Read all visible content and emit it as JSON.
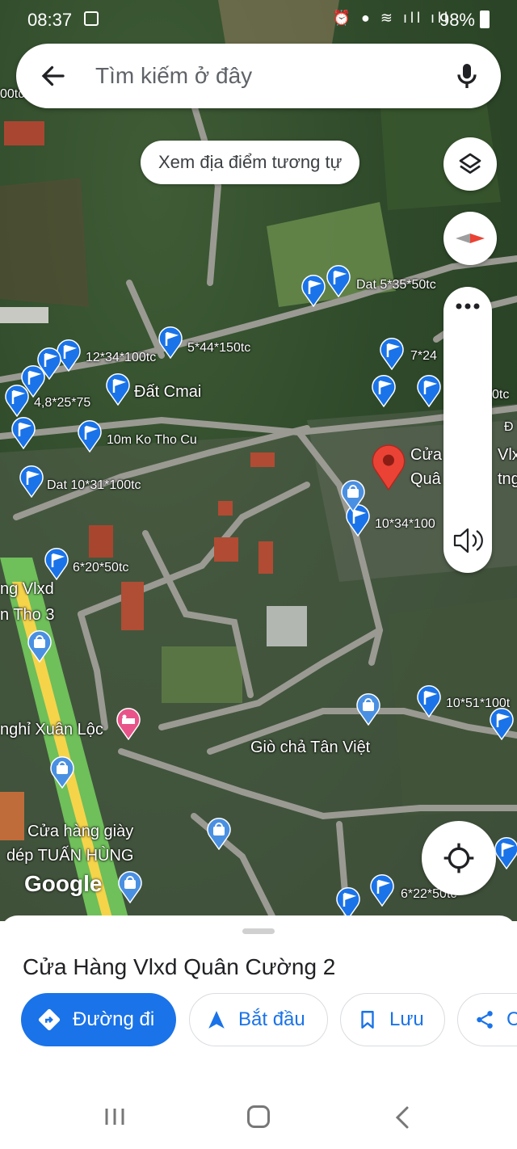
{
  "status": {
    "time": "08:37",
    "battery": "98%"
  },
  "search": {
    "placeholder": "Tìm kiếm ở đây"
  },
  "chip": {
    "label": "Xem địa điểm tương tự"
  },
  "map_labels": {
    "dat_5_35_50": "Dat 5*35*50tc",
    "l12_34_100": "12*34*100tc",
    "l5_44_150": "5*44*150tc",
    "l7_24": "7*24",
    "dat_cmai": "Đất Cmai",
    "l4_8_25_75": "4,8*25*75",
    "l10m_ko_tho_cu": "10m Ko Tho Cu",
    "dat_10_31_100": "Dat 10*31*100tc",
    "l10_34_100": "10*34*100",
    "l6_20_50": "6*20*50tc",
    "l10_51_100": "10*51*100t",
    "l6_22_50": "6*22*50tc",
    "otc_right": "0tc",
    "otc_top": "00tc",
    "d_right": "Đ",
    "tng_right": "tng",
    "cua_partial": "Cửa",
    "vlx_partial": "Vlx",
    "qua_partial": "Quâ",
    "ng_vlxd": "ng Vlxd",
    "n_tho_3": "n Tho 3",
    "nghi_xuan_loc": "nghỉ Xuân Lộc",
    "gio_cha": "Giò chả Tân Việt",
    "cua_hang_giay": "Cửa hàng giày",
    "dep_tuan_hung": "dép TUẤN HÙNG",
    "google": "Google"
  },
  "place": {
    "title": "Cửa Hàng Vlxd Quân Cường 2"
  },
  "actions": {
    "directions": "Đường đi",
    "start": "Bắt đầu",
    "save": "Lưu",
    "share": "C"
  },
  "icons": [
    "back-arrow-icon",
    "mic-icon",
    "layers-icon",
    "compass-icon",
    "more-icon",
    "sound-icon",
    "my-location-icon",
    "directions-icon",
    "navigation-icon",
    "bookmark-icon",
    "share-icon",
    "flag-pin-icon",
    "red-pin-icon",
    "shopping-bag-pin-icon",
    "hotel-pin-icon"
  ],
  "colors": {
    "accent": "#1a73e8",
    "pin_blue": "#1a73e8",
    "pin_red": "#ea4335",
    "hotel_pink": "#e8548a",
    "highway_green": "#5cb85c",
    "highway_yellow": "#f5d44a"
  }
}
